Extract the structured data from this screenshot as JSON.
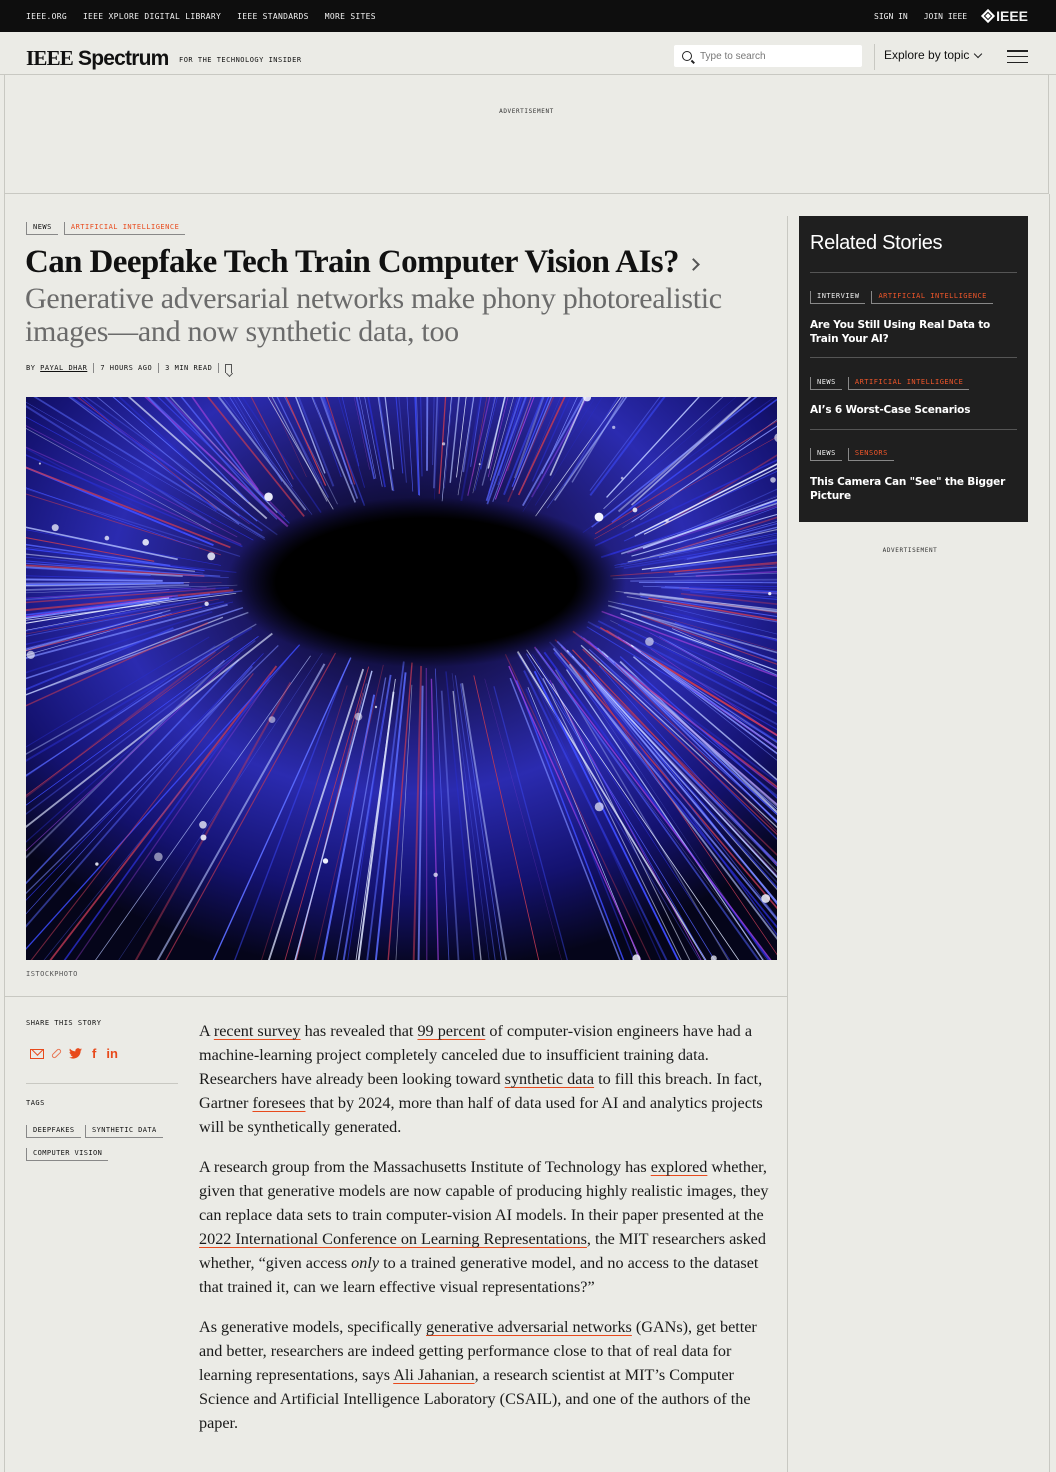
{
  "topbar": {
    "links": [
      "IEEE.ORG",
      "IEEE XPLORE DIGITAL LIBRARY",
      "IEEE STANDARDS",
      "MORE SITES"
    ],
    "sign_in": "SIGN IN",
    "join": "JOIN IEEE",
    "brand": "IEEE"
  },
  "header": {
    "logo_ieee": "IEEE",
    "logo_spectrum": "Spectrum",
    "tagline": "FOR THE TECHNOLOGY INSIDER",
    "search_placeholder": "Type to search",
    "explore_label": "Explore by topic"
  },
  "ads": {
    "top_label": "ADVERTISEMENT",
    "side_label": "ADVERTISEMENT"
  },
  "article": {
    "kind": "NEWS",
    "topic": "ARTIFICIAL INTELLIGENCE",
    "title": "Can Deepfake Tech Train Computer Vision AIs?",
    "subtitle": "Generative adversarial networks make phony photorealistic images—and now synthetic data, too",
    "by": "BY",
    "author": "PAYAL DHAR",
    "time": "7 HOURS AGO",
    "read_time": "3 MIN READ",
    "image_credit": "ISTOCKPHOTO",
    "share_label": "SHARE THIS STORY",
    "tags_label": "TAGS",
    "tags": [
      "DEEPFAKES",
      "SYNTHETIC DATA",
      "COMPUTER VISION"
    ],
    "p1": {
      "t1": "A ",
      "l1": "recent survey",
      "t2": " has revealed that ",
      "l2": "99 percent",
      "t3": " of computer-vision engineers have had a machine-learning project completely canceled due to insufficient training data. Researchers have already been looking toward ",
      "l3": "synthetic data",
      "t4": " to fill this breach. In fact, Gartner ",
      "l4": "foresees",
      "t5": " that by 2024, more than half of data used for AI and analytics projects will be synthetically generated."
    },
    "p2": {
      "t1": "A research group from the Massachusetts Institute of Technology has ",
      "l1": "explored",
      "t2": " whether, given that generative models are now capable of producing highly realistic images, they can replace data sets to train computer-vision AI models. In their paper presented at the ",
      "l2": "2022 International Conference on Learning Representations",
      "t3": ", the MIT researchers asked whether, “given access ",
      "em": "only",
      "t4": " to a trained generative model, and no access to the dataset that trained it, can we learn effective visual representations?”"
    },
    "p3": {
      "t1": "As generative models, specifically ",
      "l1": "generative adversarial networks",
      "t2": " (GANs), get better and better, researchers are indeed getting performance close to that of real data for learning representations, says ",
      "l2": "Ali Jahanian",
      "t3": ", a research scientist at MIT’s Computer Science and Artificial Intelligence Laboratory (CSAIL), and one of the authors of the paper."
    }
  },
  "related": {
    "heading": "Related Stories",
    "items": [
      {
        "kind": "INTERVIEW",
        "topic": "ARTIFICIAL INTELLIGENCE",
        "title": "Are You Still Using Real Data to Train Your AI?"
      },
      {
        "kind": "NEWS",
        "topic": "ARTIFICIAL INTELLIGENCE",
        "title": "AI’s 6 Worst-Case Scenarios"
      },
      {
        "kind": "NEWS",
        "topic": "SENSORS",
        "title": "This Camera Can \"See\" the Bigger Picture"
      }
    ]
  },
  "colors": {
    "accent": "#e84a1c",
    "background": "#ebebe6",
    "dark": "#1f1f1f"
  }
}
